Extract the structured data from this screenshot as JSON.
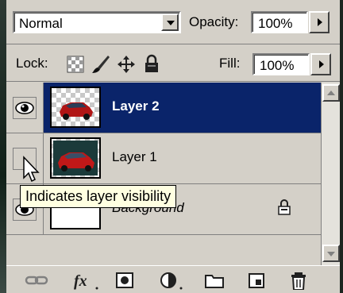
{
  "top": {
    "blend_mode": "Normal",
    "opacity_label": "Opacity:",
    "opacity_value": "100%"
  },
  "lock": {
    "lock_label": "Lock:",
    "fill_label": "Fill:",
    "fill_value": "100%"
  },
  "layers": [
    {
      "name": "Layer 2",
      "selected": true,
      "visible": true
    },
    {
      "name": "Layer 1",
      "selected": false,
      "visible": false
    },
    {
      "name": "Background",
      "selected": false,
      "visible": true,
      "locked": true
    }
  ],
  "tooltip": "Indicates layer visibility",
  "colors": {
    "selection": "#0a246a",
    "panel": "#d4d0c8",
    "tooltip_bg": "#ffffe1"
  },
  "bottom_icons": [
    "link-icon",
    "fx-icon",
    "mask-icon",
    "adjustment-icon",
    "folder-icon",
    "new-layer-icon",
    "trash-icon"
  ]
}
